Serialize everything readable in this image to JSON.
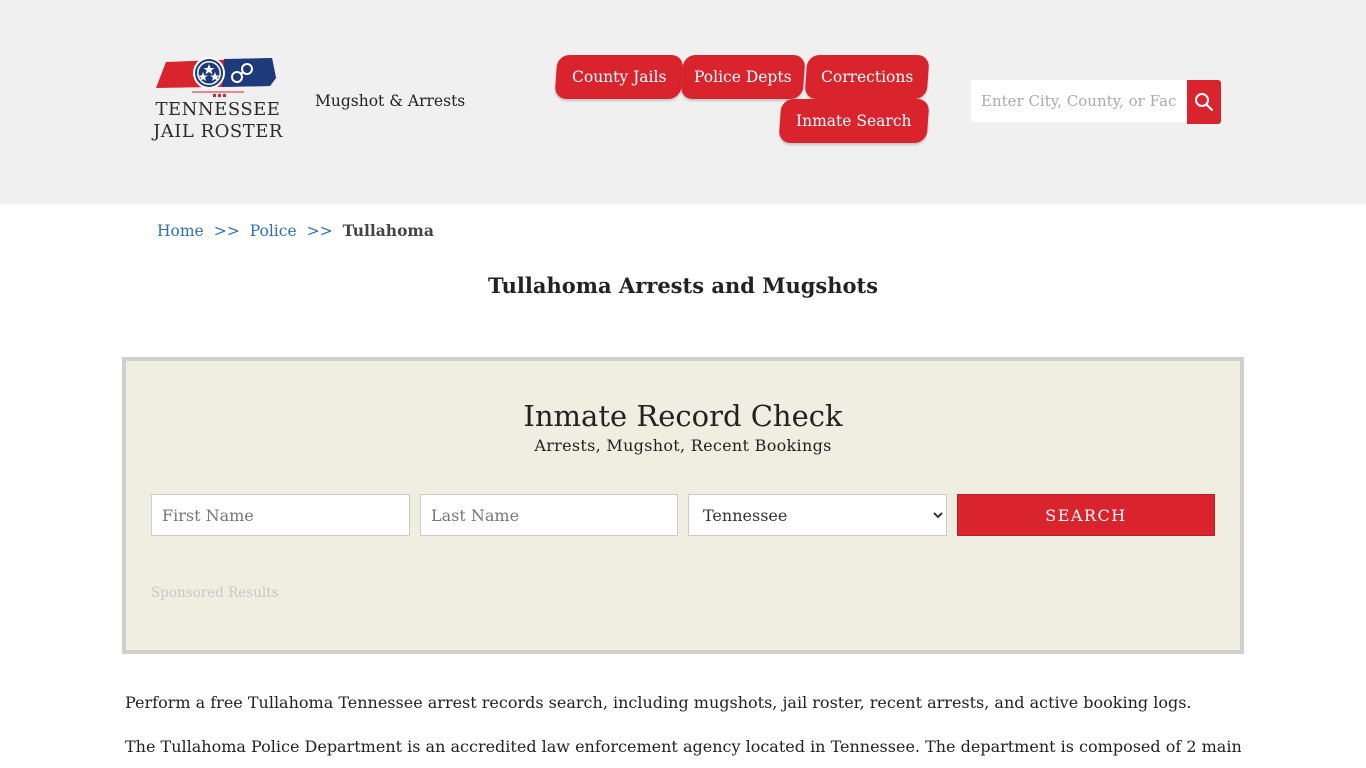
{
  "header": {
    "logo": {
      "line1": "TENNESSEE",
      "line2": "JAIL ROSTER"
    },
    "tagline": "Mugshot & Arrests",
    "nav": [
      {
        "label": "County Jails"
      },
      {
        "label": "Police Depts"
      },
      {
        "label": "Corrections"
      },
      {
        "label": "Inmate Search"
      }
    ],
    "search": {
      "placeholder": "Enter City, County, or Facility"
    }
  },
  "breadcrumb": {
    "home": "Home",
    "sep": ">>",
    "police": "Police",
    "current": "Tullahoma"
  },
  "page_title": "Tullahoma Arrests and Mugshots",
  "record_check": {
    "title": "Inmate Record Check",
    "subtitle": "Arrests, Mugshot, Recent Bookings",
    "first_name_placeholder": "First Name",
    "last_name_placeholder": "Last Name",
    "state_selected": "Tennessee",
    "search_label": "SEARCH",
    "sponsored": "Sponsored Results"
  },
  "content": {
    "p1": "Perform a free Tullahoma Tennessee arrest records search, including mugshots, jail roster, recent arrests, and active booking logs.",
    "p2": "The Tullahoma Police Department is an accredited law enforcement agency located in Tennessee. The department is composed of 2 main"
  },
  "colors": {
    "accent": "#d9232d",
    "link": "#2f6fb9",
    "header_bg": "#f0f0f0",
    "box_bg": "#f0eee0"
  }
}
